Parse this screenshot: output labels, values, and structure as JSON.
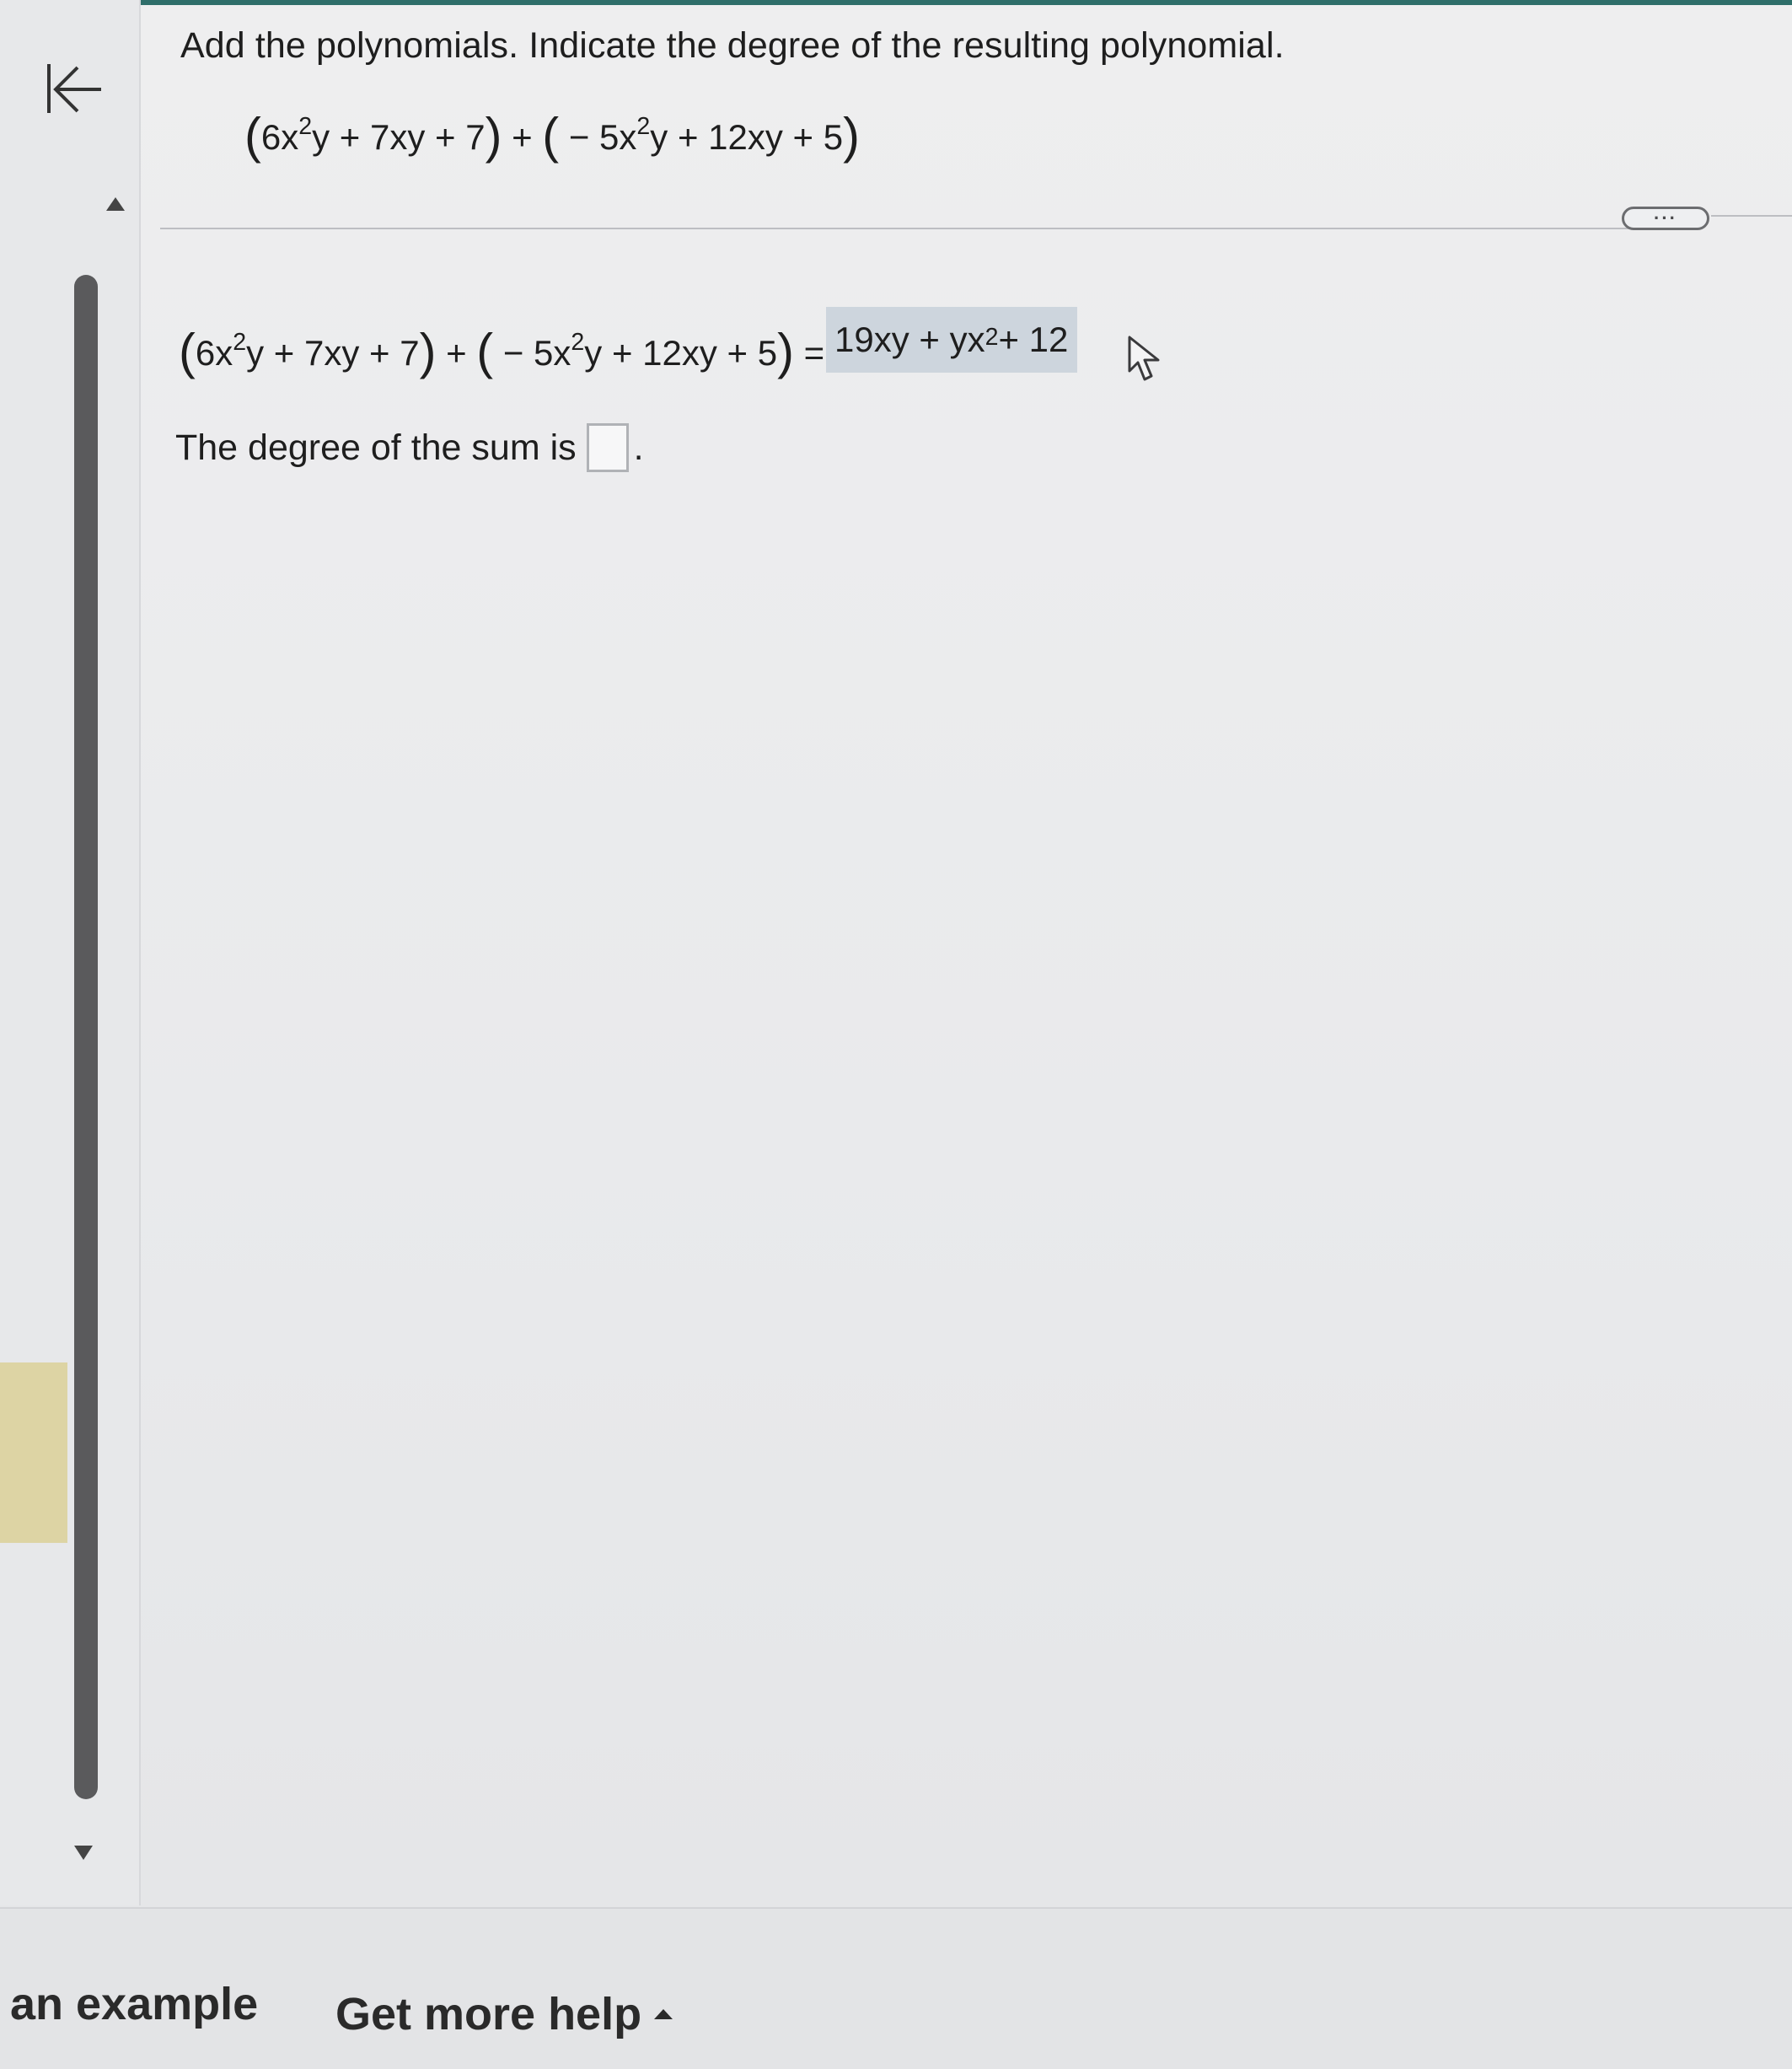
{
  "question": {
    "instruction": "Add the polynomials. Indicate the degree of the resulting polynomial."
  },
  "expression": {
    "lp1": "(",
    "p1_a": "6x",
    "p1_exp": "2",
    "p1_b": "y + 7xy + 7",
    "rp1": ")",
    "plus": " + ",
    "lp2": "(",
    "p2_a": " − 5x",
    "p2_exp": "2",
    "p2_b": "y + 12xy + 5",
    "rp2": ")"
  },
  "answer_line": {
    "equals": " = ",
    "answer_a": "19xy + yx",
    "answer_exp": "2",
    "answer_b": " + 12"
  },
  "degree": {
    "label": "The degree of the sum is",
    "value": "",
    "period": "."
  },
  "toolbar": {
    "more_label": "···"
  },
  "footer": {
    "example_label": "an example",
    "help_label": "Get more help"
  },
  "colors": {
    "accent": "#2f6e6a",
    "answer_highlight": "#cdd5dd",
    "scrollbar": "#5a5a5c",
    "note_tab": "#ddd4a4"
  }
}
